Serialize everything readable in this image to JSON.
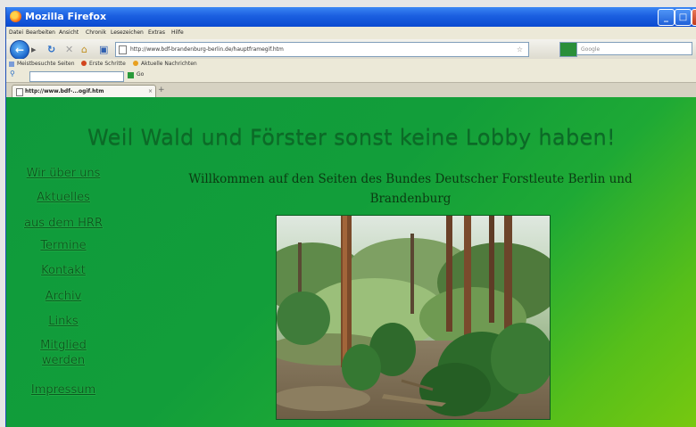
{
  "window": {
    "title": "Mozilla Firefox",
    "controls": {
      "minimize": "_",
      "maximize": "□",
      "close": "X"
    }
  },
  "menu": [
    "Datei",
    "Bearbeiten",
    "Ansicht",
    "Chronik",
    "Lesezeichen",
    "Extras",
    "Hilfe"
  ],
  "navbar": {
    "back_icon": "←",
    "url": "http://www.bdf-brandenburg-berlin.de/hauptframegif.htm",
    "search_placeholder": "Google"
  },
  "bookmarks": [
    "Meistbesuchte Seiten",
    "Erste Schritte",
    "Aktuelle Nachrichten"
  ],
  "toolbar2": {
    "go_label": "Go"
  },
  "tab": {
    "label": "http://www.bdf-...ogif.htm",
    "close": "×",
    "new_tab": "+"
  },
  "page": {
    "slogan": "Weil Wald und Förster sonst keine Lobby haben!",
    "nav": [
      "Wir über uns",
      "Aktuelles",
      "aus dem HRR",
      "Termine",
      "Kontakt",
      "Archiv",
      "Links",
      "Mitglied werden",
      "Impressum"
    ],
    "welcome": "Willkommen auf den Seiten des Bundes Deutscher Forstleute Berlin und Brandenburg"
  },
  "colors": {
    "content_green": "#129e3a",
    "content_lime": "#77c810",
    "nav_text": "#0a5a20",
    "titlebar": "#1b5fe0"
  },
  "icons": {
    "back": "back-arrow-icon",
    "forward": "forward-arrow-icon",
    "reload": "reload-icon",
    "stop": "stop-icon",
    "home": "home-icon",
    "bookmark_star": "star-icon"
  }
}
